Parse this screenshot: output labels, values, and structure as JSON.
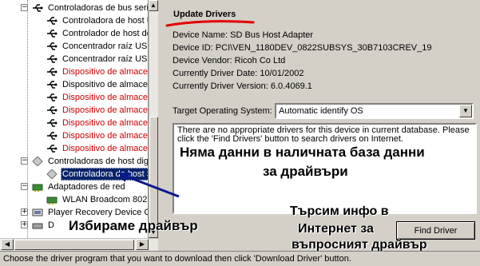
{
  "tree": {
    "items": [
      {
        "label": "Controladoras de bus serie",
        "icon": "usb-controller-icon",
        "level": 1,
        "red": false
      },
      {
        "label": "Controladora de host U",
        "icon": "usb-device-icon",
        "level": 2,
        "red": false
      },
      {
        "label": "Controlador de host de",
        "icon": "usb-device-icon",
        "level": 2,
        "red": false
      },
      {
        "label": "Concentrador raíz USB",
        "icon": "usb-device-icon",
        "level": 2,
        "red": false
      },
      {
        "label": "Concentrador raíz USB",
        "icon": "usb-device-icon",
        "level": 2,
        "red": false
      },
      {
        "label": "Dispositivo de almacer",
        "icon": "usb-device-icon",
        "level": 2,
        "red": true
      },
      {
        "label": "Dispositivo de almace",
        "icon": "usb-device-icon",
        "level": 2,
        "red": false
      },
      {
        "label": "Dispositivo de almacer",
        "icon": "usb-device-icon",
        "level": 2,
        "red": true
      },
      {
        "label": "Dispositivo de almacer",
        "icon": "usb-device-icon",
        "level": 2,
        "red": true
      },
      {
        "label": "Dispositivo de almacer",
        "icon": "usb-device-icon",
        "level": 2,
        "red": true
      },
      {
        "label": "Dispositivo de almacer",
        "icon": "usb-device-icon",
        "level": 2,
        "red": true
      },
      {
        "label": "Dispositivo de almacer",
        "icon": "usb-device-icon",
        "level": 2,
        "red": true
      },
      {
        "label": "Controladoras de host digit",
        "icon": "sd-host-icon",
        "level": 1,
        "red": false
      },
      {
        "label": "Controladora de host S",
        "icon": "sd-host-icon",
        "level": 2,
        "red": false,
        "selected": true
      },
      {
        "label": "Adaptadores de red",
        "icon": "network-adapter-icon",
        "level": 1,
        "red": false
      },
      {
        "label": "WLAN Broadcom 802",
        "icon": "network-adapter-icon",
        "level": 2,
        "red": false
      },
      {
        "label": "Player Recovery Device C",
        "icon": "recovery-device-icon",
        "level": 1,
        "red": false
      },
      {
        "label": "D",
        "icon": "drive-icon",
        "level": 1,
        "red": false
      }
    ]
  },
  "panel": {
    "title": "Update Drivers",
    "device_name": "Device Name: SD Bus Host Adapter",
    "device_id": "Device ID: PCI\\VEN_1180DEV_0822SUBSYS_30B7103CREV_19",
    "device_vendor": "Device Vendor: Ricoh Co Ltd",
    "driver_date": "Currently Driver Date: 10/01/2002",
    "driver_version": "Currently Driver Version: 6.0.4069.1",
    "os_label": "Target Operating System:",
    "os_value": "Automatic identify OS",
    "message": "There are no appropriate drivers for this device in current database. Please click the 'Find Drivers' button to search drivers on Internet.",
    "find_button": "Find Driver"
  },
  "annotations": {
    "no_data_line1": "Няма данни в наличната база данни",
    "no_data_line2": "за драйвъри",
    "choose_driver": "Избираме драйвър",
    "search_line1": "Търсим инфо в",
    "search_line2": "Интернет за",
    "search_line3": "въпросният драйвър"
  },
  "status": {
    "text": "Choose the driver program that you want to download then click 'Download Driver' button."
  },
  "colors": {
    "accent_red": "#e00000",
    "selection": "#0a246a",
    "arrow_blue": "#0a1a8c",
    "error_text": "#cc0000"
  }
}
